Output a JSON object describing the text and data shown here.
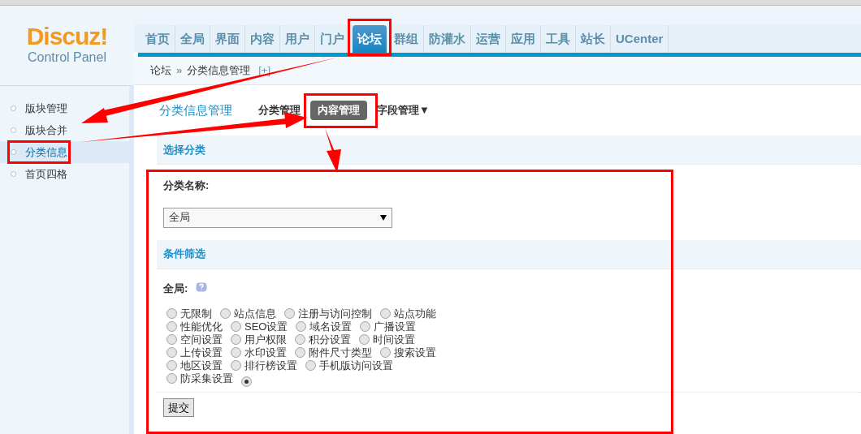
{
  "logo": {
    "brand": "Discuz!",
    "subtitle": "Control Panel"
  },
  "nav_tabs": [
    {
      "label": "首页",
      "selected": false
    },
    {
      "label": "全局",
      "selected": false
    },
    {
      "label": "界面",
      "selected": false
    },
    {
      "label": "内容",
      "selected": false
    },
    {
      "label": "用户",
      "selected": false
    },
    {
      "label": "门户",
      "selected": false
    },
    {
      "label": "论坛",
      "selected": true
    },
    {
      "label": "群组",
      "selected": false
    },
    {
      "label": "防灌水",
      "selected": false
    },
    {
      "label": "运营",
      "selected": false
    },
    {
      "label": "应用",
      "selected": false
    },
    {
      "label": "工具",
      "selected": false
    },
    {
      "label": "站长",
      "selected": false
    },
    {
      "label": "UCenter",
      "selected": false
    }
  ],
  "breadcrumb": {
    "parent": "论坛",
    "separator": "»",
    "current": "分类信息管理",
    "toggle": "[+]"
  },
  "sidebar": {
    "items": [
      {
        "label": "版块管理",
        "selected": false
      },
      {
        "label": "版块合并",
        "selected": false
      },
      {
        "label": "分类信息",
        "selected": true
      },
      {
        "label": "首页四格",
        "selected": false
      }
    ]
  },
  "page_title": "分类信息管理",
  "sub_tabs": [
    {
      "label": "分类管理",
      "selected": false
    },
    {
      "label": "内容管理",
      "selected": true
    },
    {
      "label": "字段管理▼",
      "selected": false
    }
  ],
  "section_select": {
    "title": "选择分类",
    "field_label": "分类名称:",
    "select_value": "全局"
  },
  "section_filter": {
    "title": "条件筛选",
    "field_label": "全局:",
    "options": [
      {
        "label": "无限制",
        "selected": false
      },
      {
        "label": "站点信息",
        "selected": false
      },
      {
        "label": "注册与访问控制",
        "selected": false
      },
      {
        "label": "站点功能",
        "selected": false
      },
      {
        "label": "性能优化",
        "selected": false
      },
      {
        "label": "SEO设置",
        "selected": false
      },
      {
        "label": "域名设置",
        "selected": false
      },
      {
        "label": "广播设置",
        "selected": false
      },
      {
        "label": "空间设置",
        "selected": false
      },
      {
        "label": "用户权限",
        "selected": false
      },
      {
        "label": "积分设置",
        "selected": false
      },
      {
        "label": "时间设置",
        "selected": false
      },
      {
        "label": "上传设置",
        "selected": false
      },
      {
        "label": "水印设置",
        "selected": false
      },
      {
        "label": "附件尺寸类型",
        "selected": false
      },
      {
        "label": "搜索设置",
        "selected": false
      },
      {
        "label": "地区设置",
        "selected": false
      },
      {
        "label": "排行榜设置",
        "selected": false
      },
      {
        "label": "手机版访问设置",
        "selected": false
      },
      {
        "label": "防采集设置",
        "selected": false
      },
      {
        "selected": true
      }
    ]
  },
  "submit_button": "提交"
}
